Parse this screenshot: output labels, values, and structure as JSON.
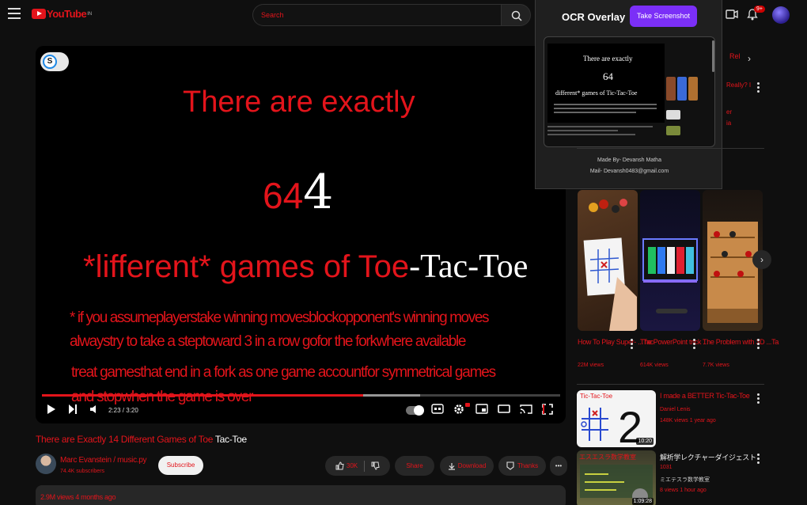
{
  "colors": {
    "ocr_red": "#e3141b",
    "ocr_accent": "#7b2ff7",
    "bg": "#0f0f0f"
  },
  "header": {
    "logo_text": "YouTube",
    "logo_sup": "IN",
    "search_placeholder": "Search",
    "notification_count": "9+",
    "icons": [
      "menu-icon",
      "search-icon",
      "create-icon",
      "bell-icon"
    ]
  },
  "video": {
    "line1": "There are exactly",
    "line2_red": "64",
    "line2_white": "4",
    "line3_red": "*lifferent* games of Toe",
    "line3_white": "-Tac-Toe",
    "line4": "* if you assumeplayerstake winning movesblockopponent's winning moves",
    "line5": "alwaystry to take a steptoward 3 in a row gofor the forkwhere available",
    "line6": "treat gamesthat end in a fork as one game accountfor symmetrical games",
    "line7": "and stopwhen the game is over",
    "time": "2:23 / 3:20",
    "progress_fraction": 0.62,
    "buffered_fraction": 0.73
  },
  "meta": {
    "title_red": "There are Exactly 14 Different Games of Toe",
    "title_white": " Tac-Toe",
    "channel": "Marc Evanstein / music.py",
    "subscribers": "74.4K subscribers",
    "subscribe": "Subscribe",
    "like_count": "30K",
    "share": "Share",
    "download": "Download",
    "thanks": "Thanks",
    "views_date": "2.9M views  4 months ago"
  },
  "ocr_popup": {
    "title": "OCR Overlay",
    "button": "Take Screenshot",
    "credit1": "Made By- Devansh Matha",
    "credit2": "Mail- Devansh0483@gmail.com",
    "preview_line1": "There are exactly",
    "preview_line2": "64",
    "preview_line3": "different* games of Tic-Tac-Toe"
  },
  "sidebar": {
    "chip_text": "Rel",
    "frag1": "Really? I",
    "frag2": "er",
    "frag3": "ia",
    "shorts": [
      {
        "title": "How To Play Super- ...Tac-",
        "views": "22M views"
      },
      {
        "title": "The PowerPoint trick ...",
        "views": "614K views"
      },
      {
        "title": "The Problem with 3D ...Ta",
        "views": "7.7K views"
      }
    ],
    "related": [
      {
        "title": "I made a BETTER Tic-Tac-Toe",
        "channel": "Daniel Lenis",
        "meta": "148K views  1 year ago",
        "duration": "10:20",
        "thumb_text": "Tic-Tac-Toe"
      },
      {
        "title": "解析学レクチャーダイジェスト",
        "channel": "1031",
        "meta": "8 views  1 hour ago",
        "channel2": "ミエテスラ数学教室",
        "duration": "1:09:28",
        "thumb_text": "エスエスラ数学教室"
      }
    ]
  }
}
